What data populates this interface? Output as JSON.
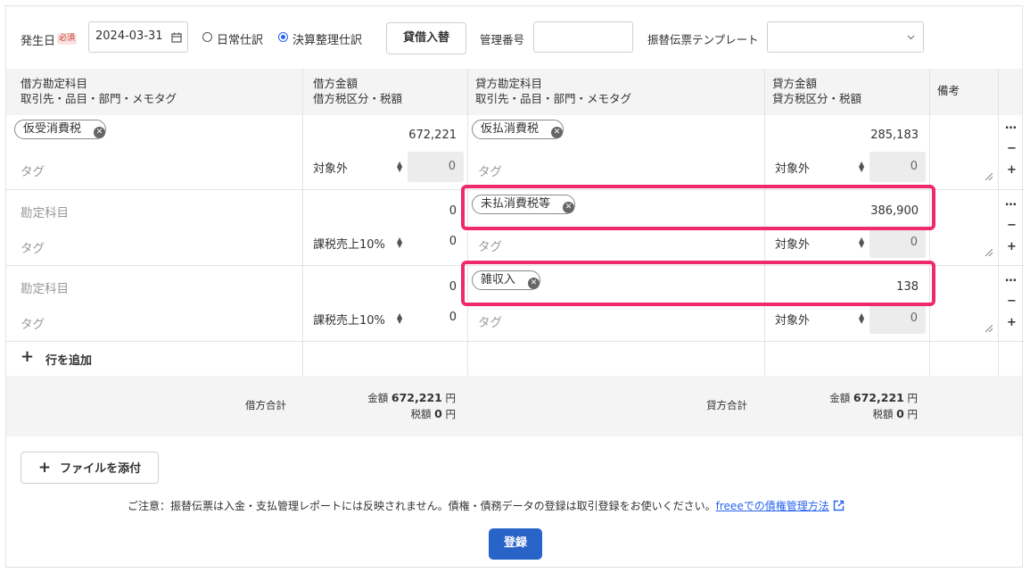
{
  "header": {
    "issue_date_label": "発生日",
    "required_badge": "必須",
    "issue_date_value": "2024-03-31",
    "radio_normal_label": "日常仕訳",
    "radio_closing_label": "決算整理仕訳",
    "swap_button_label": "貸借入替",
    "manage_no_label": "管理番号",
    "manage_no_value": "",
    "template_label": "振替伝票テンプレート",
    "template_value": ""
  },
  "columns": {
    "debit_account_line1": "借方勘定科目",
    "debit_account_line2": "取引先・品目・部門・メモタグ",
    "debit_amount_line1": "借方金額",
    "debit_amount_line2": "借方税区分・税額",
    "credit_account_line1": "貸方勘定科目",
    "credit_account_line2": "取引先・品目・部門・メモタグ",
    "credit_amount_line1": "貸方金額",
    "credit_amount_line2": "貸方税区分・税額",
    "memo": "備考"
  },
  "placeholders": {
    "account": "勘定科目",
    "tag": "タグ"
  },
  "rows": [
    {
      "debit_account": "仮受消費税",
      "debit_amount": "672,221",
      "debit_tax_category": "対象外",
      "debit_tax": "0",
      "credit_account": "仮払消費税",
      "credit_amount": "285,183",
      "credit_tax_category": "対象外",
      "credit_tax": "0"
    },
    {
      "debit_account": "",
      "debit_amount": "0",
      "debit_tax_category": "課税売上10%",
      "debit_tax": "0",
      "credit_account": "未払消費税等",
      "credit_amount": "386,900",
      "credit_tax_category": "対象外",
      "credit_tax": "0"
    },
    {
      "debit_account": "",
      "debit_amount": "0",
      "debit_tax_category": "課税売上10%",
      "debit_tax": "0",
      "credit_account": "雑収入",
      "credit_amount": "138",
      "credit_tax_category": "対象外",
      "credit_tax": "0"
    }
  ],
  "row_controls": {
    "more": "…",
    "remove": "−",
    "add": "+"
  },
  "add_row_label": "行を追加",
  "totals": {
    "debit_label": "借方合計",
    "credit_label": "貸方合計",
    "amount_prefix": "金額",
    "tax_prefix": "税額",
    "yen": "円",
    "debit_amount": "672,221",
    "debit_tax": "0",
    "credit_amount": "672,221",
    "credit_tax": "0"
  },
  "attach_file_label": "ファイルを添付",
  "notice_text": "ご注意：振替伝票は入金・支払管理レポートには反映されません。債権・債務データの登録は取引登録をお使いください。",
  "notice_link": "freeeでの債権管理方法",
  "submit_label": "登録",
  "colors": {
    "accent": "#2864c8",
    "highlight": "#ee2a6b"
  }
}
